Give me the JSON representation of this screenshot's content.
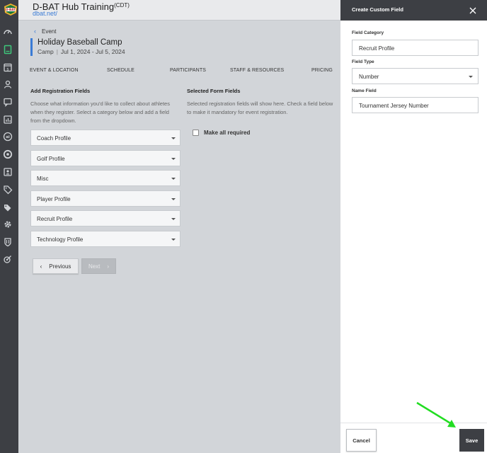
{
  "header": {
    "title": "D-BAT Hub Training",
    "timezone": "(CDT)",
    "link": "dbat.net/"
  },
  "rail": {
    "icons": [
      "dashboard-icon",
      "book-icon",
      "calendar-dollar-icon",
      "users-icon",
      "chat-icon",
      "chart-icon",
      "ai-icon",
      "headset-icon",
      "id-card-icon",
      "tag-icon",
      "tags-icon",
      "gear-icon",
      "shield-icon",
      "stats-icon"
    ]
  },
  "event": {
    "back_label": "Event",
    "title": "Holiday Baseball Camp",
    "type": "Camp",
    "dates": "Jul 1, 2024 - Jul 5, 2024"
  },
  "tabs": [
    "EVENT & LOCATION",
    "SCHEDULE",
    "PARTICIPANTS",
    "STAFF & RESOURCES",
    "PRICING"
  ],
  "left": {
    "title": "Add Registration Fields",
    "description": "Choose what information you'd like to collect about athletes when they register. Select a category below and add a field from the dropdown.",
    "categories": [
      "Coach Profile",
      "Golf Profile",
      "Misc",
      "Player Profile",
      "Recruit Profile",
      "Technology Profile"
    ]
  },
  "right": {
    "title": "Selected Form Fields",
    "description": "Selected registration fields will show here. Check a field below to make it mandatory for event registration.",
    "make_all_required": "Make all required"
  },
  "nav": {
    "previous": "Previous",
    "next": "Next"
  },
  "panel": {
    "title": "Create Custom Field",
    "category_label": "Field Category",
    "category_value": "Recruit Profile",
    "type_label": "Field Type",
    "type_value": "Number",
    "name_label": "Name Field",
    "name_value": "Tournament Jersey Number",
    "cancel": "Cancel",
    "save": "Save"
  },
  "colors": {
    "accent": "#3a7bd5",
    "dark": "#3d3f44",
    "arrow": "#22dd22"
  }
}
